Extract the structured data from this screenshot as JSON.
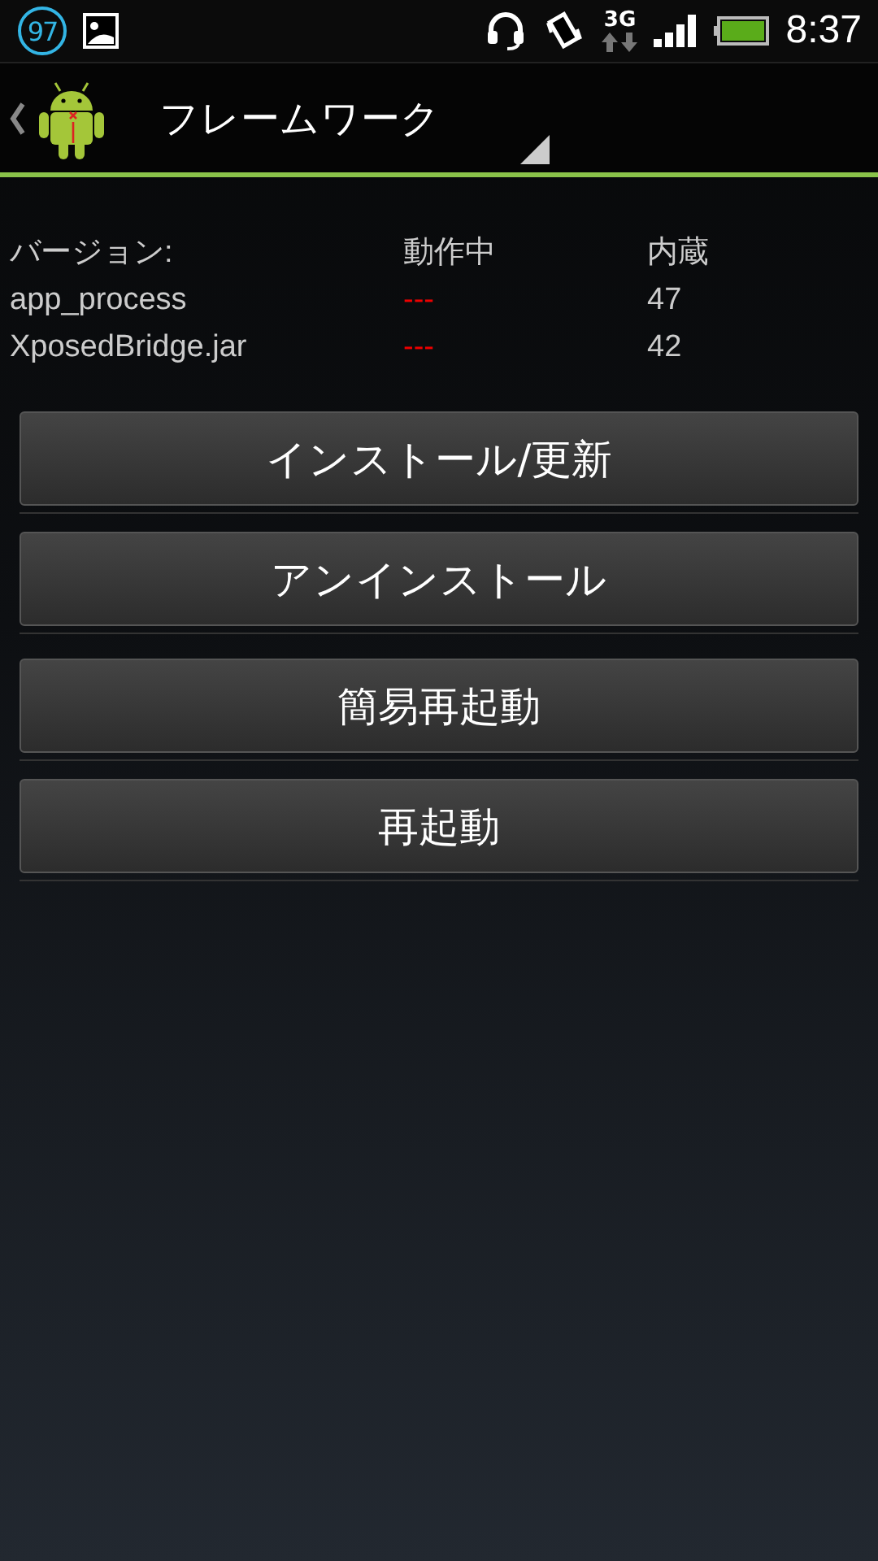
{
  "status_bar": {
    "badge": "97",
    "network": "3G",
    "time": "8:37"
  },
  "action_bar": {
    "title": "フレームワーク"
  },
  "versions": {
    "columns": [
      "バージョン:",
      "動作中",
      "内蔵"
    ],
    "rows": [
      {
        "name": "app_process",
        "active": "---",
        "running": false,
        "builtin": "47"
      },
      {
        "name": "XposedBridge.jar",
        "active": "---",
        "running": false,
        "builtin": "42"
      }
    ]
  },
  "button_groups": [
    [
      "インストール/更新",
      "アンインストール"
    ],
    [
      "簡易再起動",
      "再起動"
    ]
  ]
}
